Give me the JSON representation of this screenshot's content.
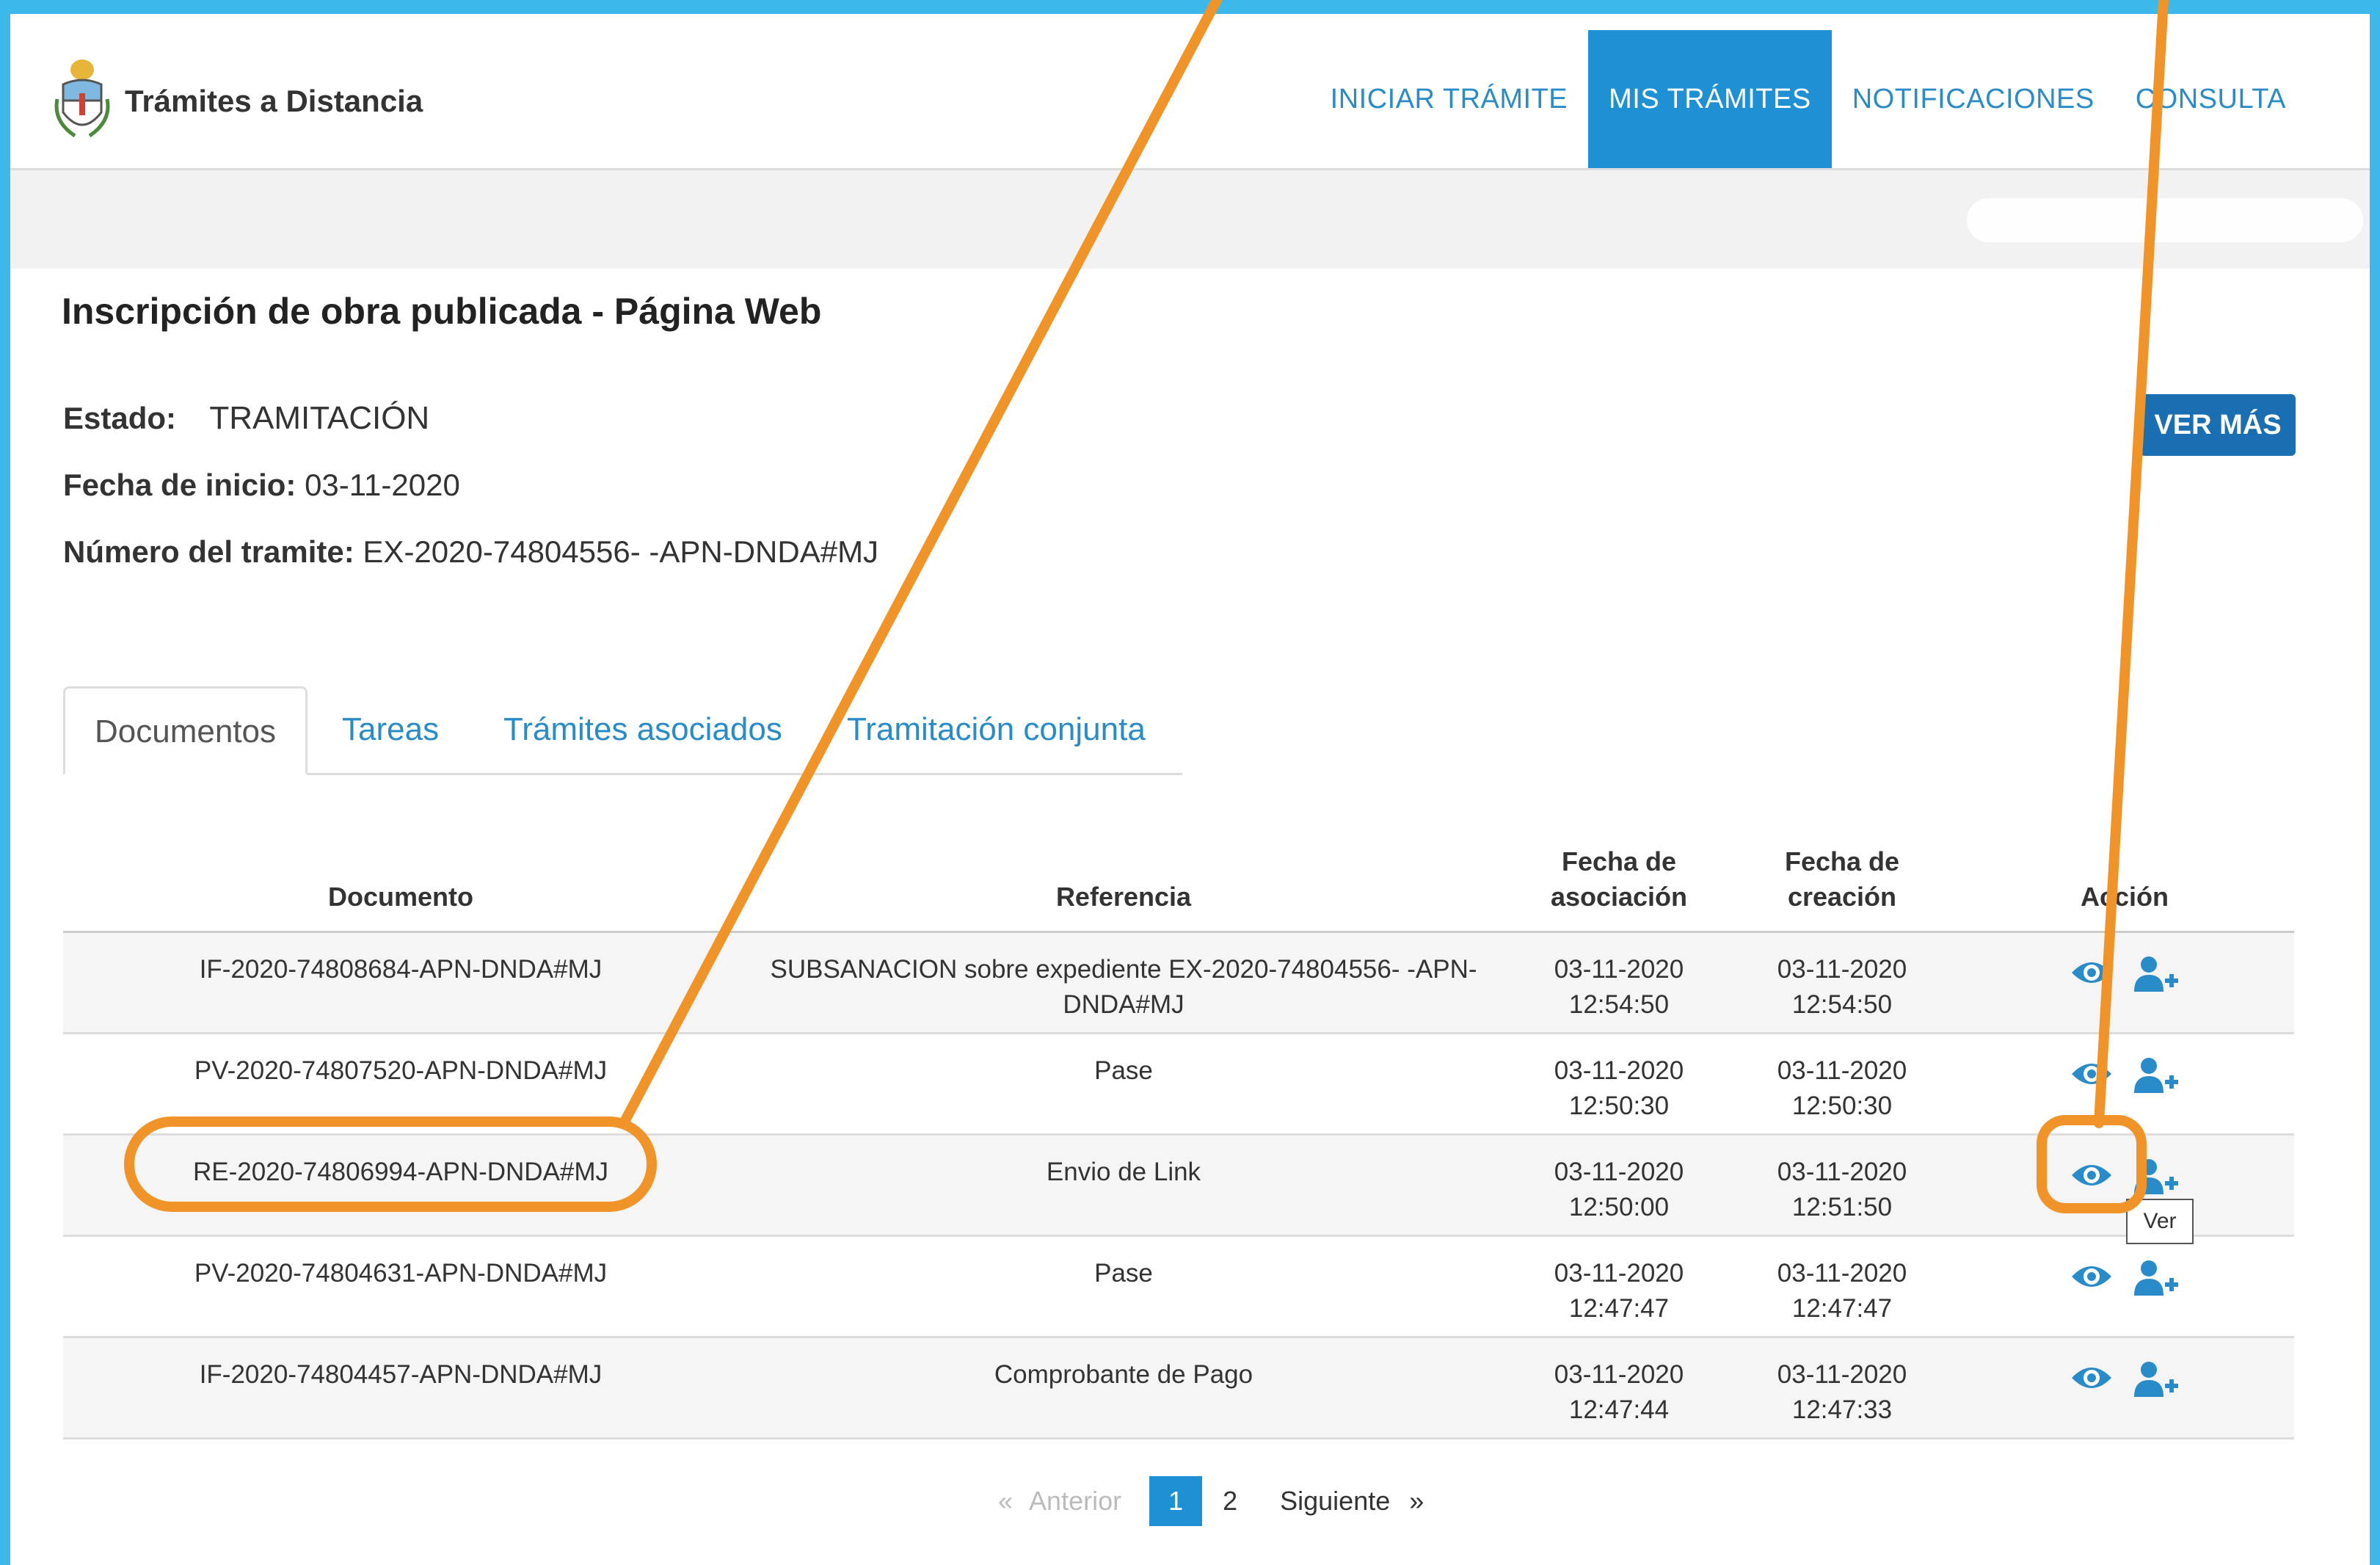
{
  "header": {
    "brand": "Trámites a Distancia",
    "nav": [
      "INICIAR TRÁMITE",
      "MIS TRÁMITES",
      "NOTIFICACIONES",
      "CONSULTA"
    ],
    "active_nav": "MIS TRÁMITES"
  },
  "page": {
    "title": "Inscripción de obra publicada - Página Web",
    "estado_label": "Estado:",
    "estado_value": "TRAMITACIÓN",
    "fecha_label": "Fecha de inicio:",
    "fecha_value": "03-11-2020",
    "numero_label": "Número del tramite:",
    "numero_value": "EX-2020-74804556- -APN-DNDA#MJ",
    "ver_mas": "VER MÁS"
  },
  "tabs": [
    "Documentos",
    "Tareas",
    "Trámites asociados",
    "Tramitación conjunta"
  ],
  "active_tab": "Documentos",
  "table": {
    "headers": {
      "documento": "Documento",
      "referencia": "Referencia",
      "fecha_asociacion_1": "Fecha de",
      "fecha_asociacion_2": "asociación",
      "fecha_creacion_1": "Fecha de",
      "fecha_creacion_2": "creación",
      "accion": "Acción"
    },
    "rows": [
      {
        "documento": "IF-2020-74808684-APN-DNDA#MJ",
        "referencia_1": "SUBSANACION sobre expediente EX-2020-74804556- -APN-",
        "referencia_2": "DNDA#MJ",
        "asoc_fecha": "03-11-2020",
        "asoc_hora": "12:54:50",
        "crea_fecha": "03-11-2020",
        "crea_hora": "12:54:50"
      },
      {
        "documento": "PV-2020-74807520-APN-DNDA#MJ",
        "referencia_1": "Pase",
        "referencia_2": "",
        "asoc_fecha": "03-11-2020",
        "asoc_hora": "12:50:30",
        "crea_fecha": "03-11-2020",
        "crea_hora": "12:50:30"
      },
      {
        "documento": "RE-2020-74806994-APN-DNDA#MJ",
        "referencia_1": "Envio de Link",
        "referencia_2": "",
        "asoc_fecha": "03-11-2020",
        "asoc_hora": "12:50:00",
        "crea_fecha": "03-11-2020",
        "crea_hora": "12:51:50"
      },
      {
        "documento": "PV-2020-74804631-APN-DNDA#MJ",
        "referencia_1": "Pase",
        "referencia_2": "",
        "asoc_fecha": "03-11-2020",
        "asoc_hora": "12:47:47",
        "crea_fecha": "03-11-2020",
        "crea_hora": "12:47:47"
      },
      {
        "documento": "IF-2020-74804457-APN-DNDA#MJ",
        "referencia_1": "Comprobante de Pago",
        "referencia_2": "",
        "asoc_fecha": "03-11-2020",
        "asoc_hora": "12:47:44",
        "crea_fecha": "03-11-2020",
        "crea_hora": "12:47:33"
      }
    ],
    "action_icons": [
      "eye-icon",
      "add-user-icon"
    ],
    "tooltip": "Ver"
  },
  "pagination": {
    "prev_arrow": "«",
    "prev": "Anterior",
    "pages": [
      "1",
      "2"
    ],
    "current": "1",
    "next": "Siguiente",
    "next_arrow": "»"
  },
  "colors": {
    "frame": "#3cb8ea",
    "nav_active": "#1e90d3",
    "link": "#2a8bc9",
    "button": "#1a6fb3",
    "annotation": "#f0942a"
  }
}
